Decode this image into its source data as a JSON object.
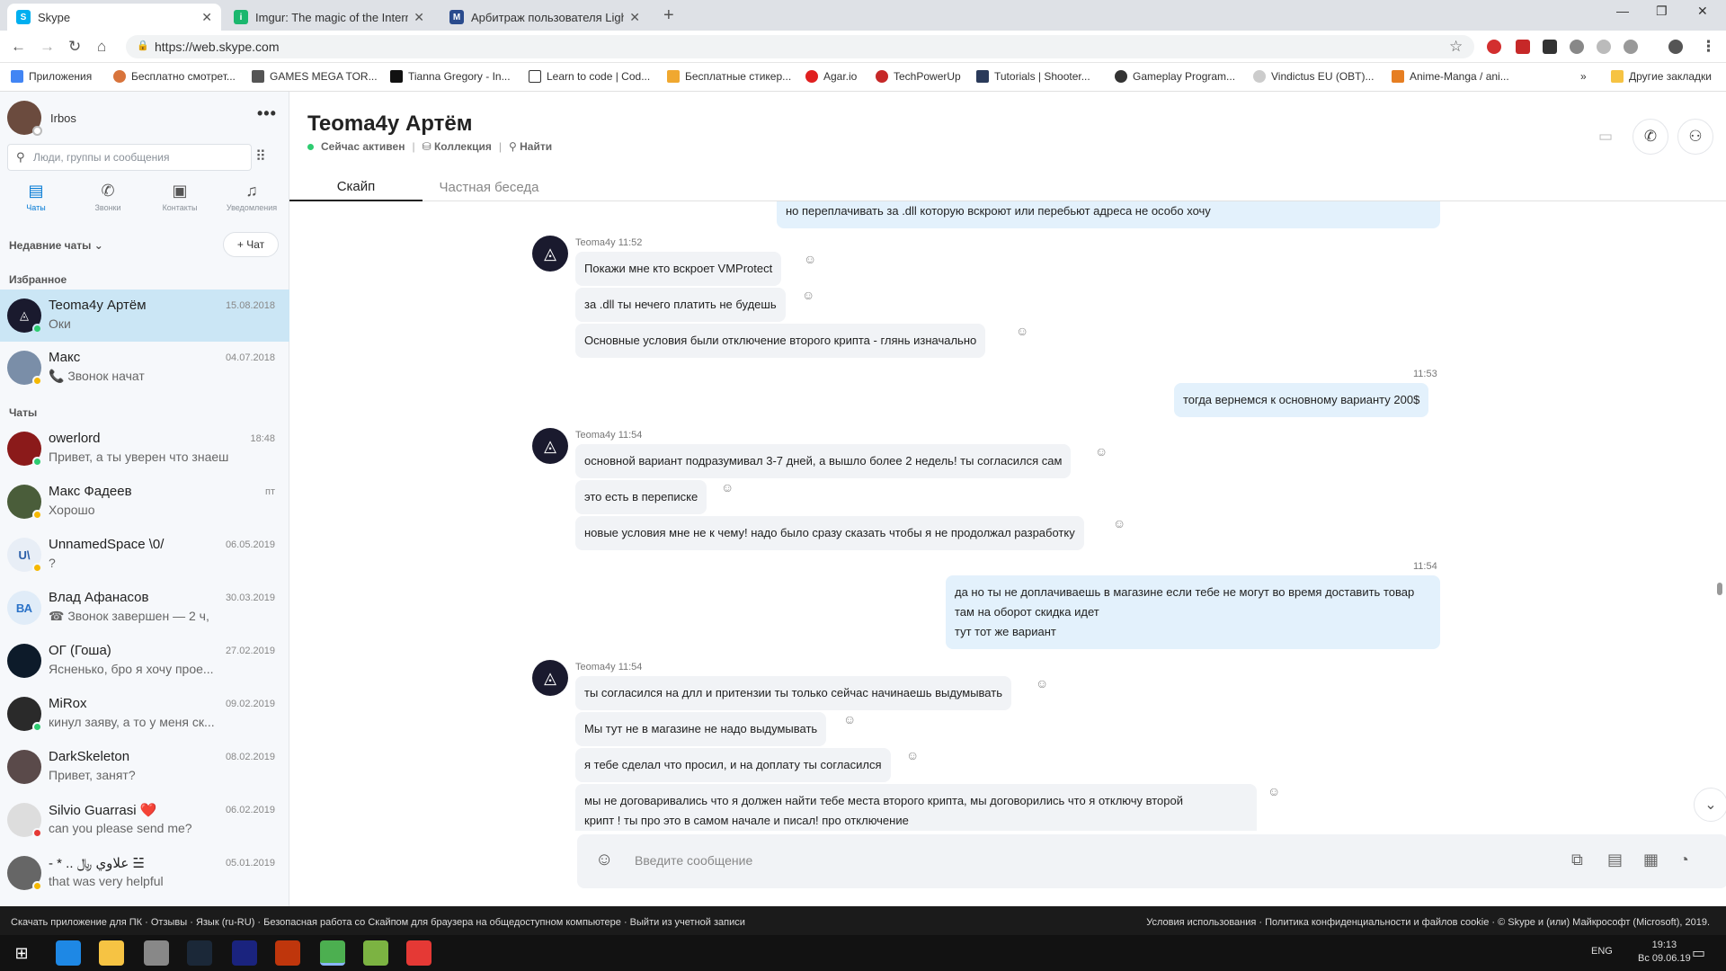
{
  "browser": {
    "tabs": [
      {
        "label": "Skype",
        "active": true
      },
      {
        "label": "Imgur: The magic of the Internet"
      },
      {
        "label": "Арбитраж пользователя LightF..."
      }
    ],
    "new_tab_glyph": "+",
    "url": "https://web.skype.com",
    "bookmarks": [
      "Приложения",
      "Бесплатно смотрет...",
      "GAMES MEGA TOR...",
      "Tianna Gregory - In...",
      "Learn to code | Cod...",
      "Бесплатные стикер...",
      "Agar.io",
      "TechPowerUp",
      "Tutorials | Shooter...",
      "Gameplay Program...",
      "Vindictus EU (OBT)...",
      "Anime-Manga / ani..."
    ],
    "bookmarks_overflow": "»",
    "other_bookmarks": "Другие закладки"
  },
  "sidebar": {
    "profile_name": "Irbos",
    "search_placeholder": "Люди, группы и сообщения",
    "nav": [
      {
        "label": "Чаты",
        "icon": "chat-icon",
        "active": true
      },
      {
        "label": "Звонки",
        "icon": "phone-icon"
      },
      {
        "label": "Контакты",
        "icon": "contacts-icon"
      },
      {
        "label": "Уведомления",
        "icon": "bell-icon"
      }
    ],
    "recent_label": "Недавние чаты",
    "new_chat_label": "+ Чат",
    "favorites_label": "Избранное",
    "chats_label": "Чаты",
    "favorites": [
      {
        "name": "Teoma4y Артём",
        "msg": "Оки",
        "date": "15.08.2018",
        "selected": true
      },
      {
        "name": "Макс",
        "msg": "📞 Звонок начат",
        "date": "04.07.2018"
      }
    ],
    "chats": [
      {
        "name": "owerlord",
        "msg": "Привет, а ты уверен что знаеш...",
        "date": "18:48"
      },
      {
        "name": "Макс Фадеев",
        "msg": "Хорошо",
        "date": "пт"
      },
      {
        "name": "UnnamedSpace \\0/",
        "msg": "?",
        "date": "06.05.2019"
      },
      {
        "name": "Влад Афанасов",
        "msg": "☎ Звонок завершен — 2 ч,",
        "date": "30.03.2019"
      },
      {
        "name": "ОГ (Гоша)",
        "msg": "Ясненько, бро я хочу прое...",
        "date": "27.02.2019"
      },
      {
        "name": "MiRox",
        "msg": "кинул заяву, а то у меня ск...",
        "date": "09.02.2019"
      },
      {
        "name": "DarkSkeleton",
        "msg": "Привет, занят?",
        "date": "08.02.2019"
      },
      {
        "name": "Silvio Guarrasi ❤️",
        "msg": "can you please send me?",
        "date": "06.02.2019"
      },
      {
        "name": "- * .. علاوي ﷼ ☱",
        "msg": "that was very helpful",
        "date": "05.01.2019"
      }
    ]
  },
  "conversation": {
    "title": "Teoma4y Артём",
    "status": "Сейчас активен",
    "collection": "Коллекция",
    "find": "Найти",
    "tabs": [
      "Скайп",
      "Частная беседа"
    ],
    "input_placeholder": "Введите сообщение",
    "messages": {
      "top_out": "но переплачивать за .dll которую вскроют или перебьют адреса не особо хочу",
      "g1_meta": "Teoma4y 11:52",
      "g1": [
        "Покажи мне кто вскроет VMProtect",
        "за .dll ты нечего платить не будешь",
        "Основные условия были отключение второго крипта - глянь изначально"
      ],
      "o1_time": "11:53",
      "o1": "тогда вернемся к основному варианту 200$",
      "g2_meta": "Teoma4y 11:54",
      "g2": [
        "основной вариант подразумивал 3-7 дней, а вышло более 2 недель! ты согласился сам",
        "это есть в переписке",
        "новые условия мне не к чему! надо было сразу сказать чтобы я не продолжал разработку"
      ],
      "o2_time": "11:54",
      "o2": [
        "да но ты не доплачиваешь в магазине если тебе не могут во время доставить товар",
        "там на оборот скидка идет",
        "тут тот же вариант"
      ],
      "g3_meta": "Teoma4y 11:54",
      "g3": [
        "ты согласился на длл и притензии ты только сейчас начинаешь выдумывать",
        "Мы тут не в магазине не надо выдумывать",
        "я тебе сделал что просил, и на доплату ты согласился"
      ],
      "g3_long": [
        "мы не договаривались что я должен найти тебе места второго крипта, мы договорились что я отключу второй",
        "крипт ! ты про это в самом начале и писал! про отключение"
      ]
    }
  },
  "footer": {
    "left": "Скачать приложение для ПК · Отзывы · Язык (ru-RU) · Безопасная работа со Скайпом для браузера на общедоступном компьютере · Выйти из учетной записи",
    "right": "Условия использования · Политика конфиденциальности и файлов cookie · © Skype и (или) Майкрософт (Microsoft), 2019."
  },
  "taskbar": {
    "lang": "ENG",
    "time": "19:13",
    "date": "Вс 09.06.19"
  }
}
